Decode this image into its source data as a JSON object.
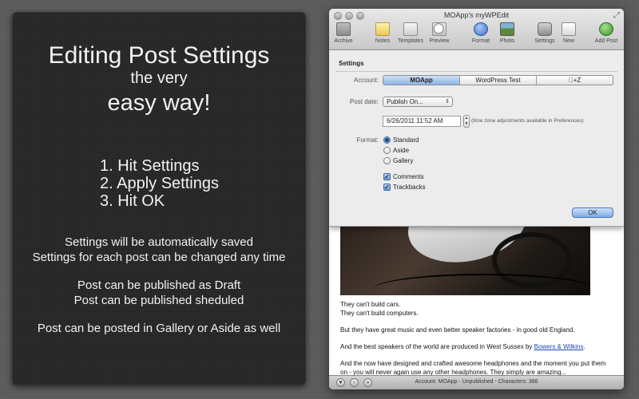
{
  "promo": {
    "title_line1": "Editing Post Settings",
    "title_line2": "the very",
    "title_line3": "easy way!",
    "steps": [
      "1. Hit Settings",
      "2. Apply Settings",
      "3. Hit OK"
    ],
    "notes": [
      "Settings will be automatically saved",
      "Settings for each post can be changed any time",
      "Post can be published as Draft",
      "Post can be published sheduled",
      "Post can be posted in Gallery or Aside as well"
    ]
  },
  "window": {
    "title": "MOApp's myWPEdit",
    "resize_icon": "⤢",
    "toolbar": {
      "archive": "Archive",
      "notes": "Notes",
      "templates": "Templates",
      "preview": "Preview",
      "format": "Format",
      "photo": "Photo",
      "settings": "Settings",
      "new": "New",
      "add_post": "Add Post"
    }
  },
  "settings": {
    "title": "Settings",
    "account_label": "Account:",
    "accounts": [
      "MOApp",
      "WordPress Test",
      "+Z"
    ],
    "post_date_label": "Post date:",
    "post_date_value": "Publish On...",
    "date_time": "6/26/2011 11:52 AM",
    "tz_note": "(time zone adjustments available in Preferences)",
    "format_label": "Format:",
    "formats": [
      "Standard",
      "Aside",
      "Gallery"
    ],
    "selected_format": "Standard",
    "comments_label": "Comments",
    "trackbacks_label": "Trackbacks",
    "comments_checked": true,
    "trackbacks_checked": true,
    "ok_label": "OK"
  },
  "document": {
    "p1_line1": "They can't build cars.",
    "p1_line2": "They can't build computers.",
    "p2": "But they have great music and even better speaker factories - in good old England.",
    "p3_prefix": "And the best speakers of the world are produced in West Sussex by ",
    "p3_link": "Bowers & Wilkins",
    "p3_suffix": ".",
    "p4": "And the now have designed and crafted awesome headphones and the moment you put them on - you will never again use any other headphones. They simply are amazing..."
  },
  "status": {
    "text": "Account: MOApp - Unpublished - Characters: 386"
  }
}
